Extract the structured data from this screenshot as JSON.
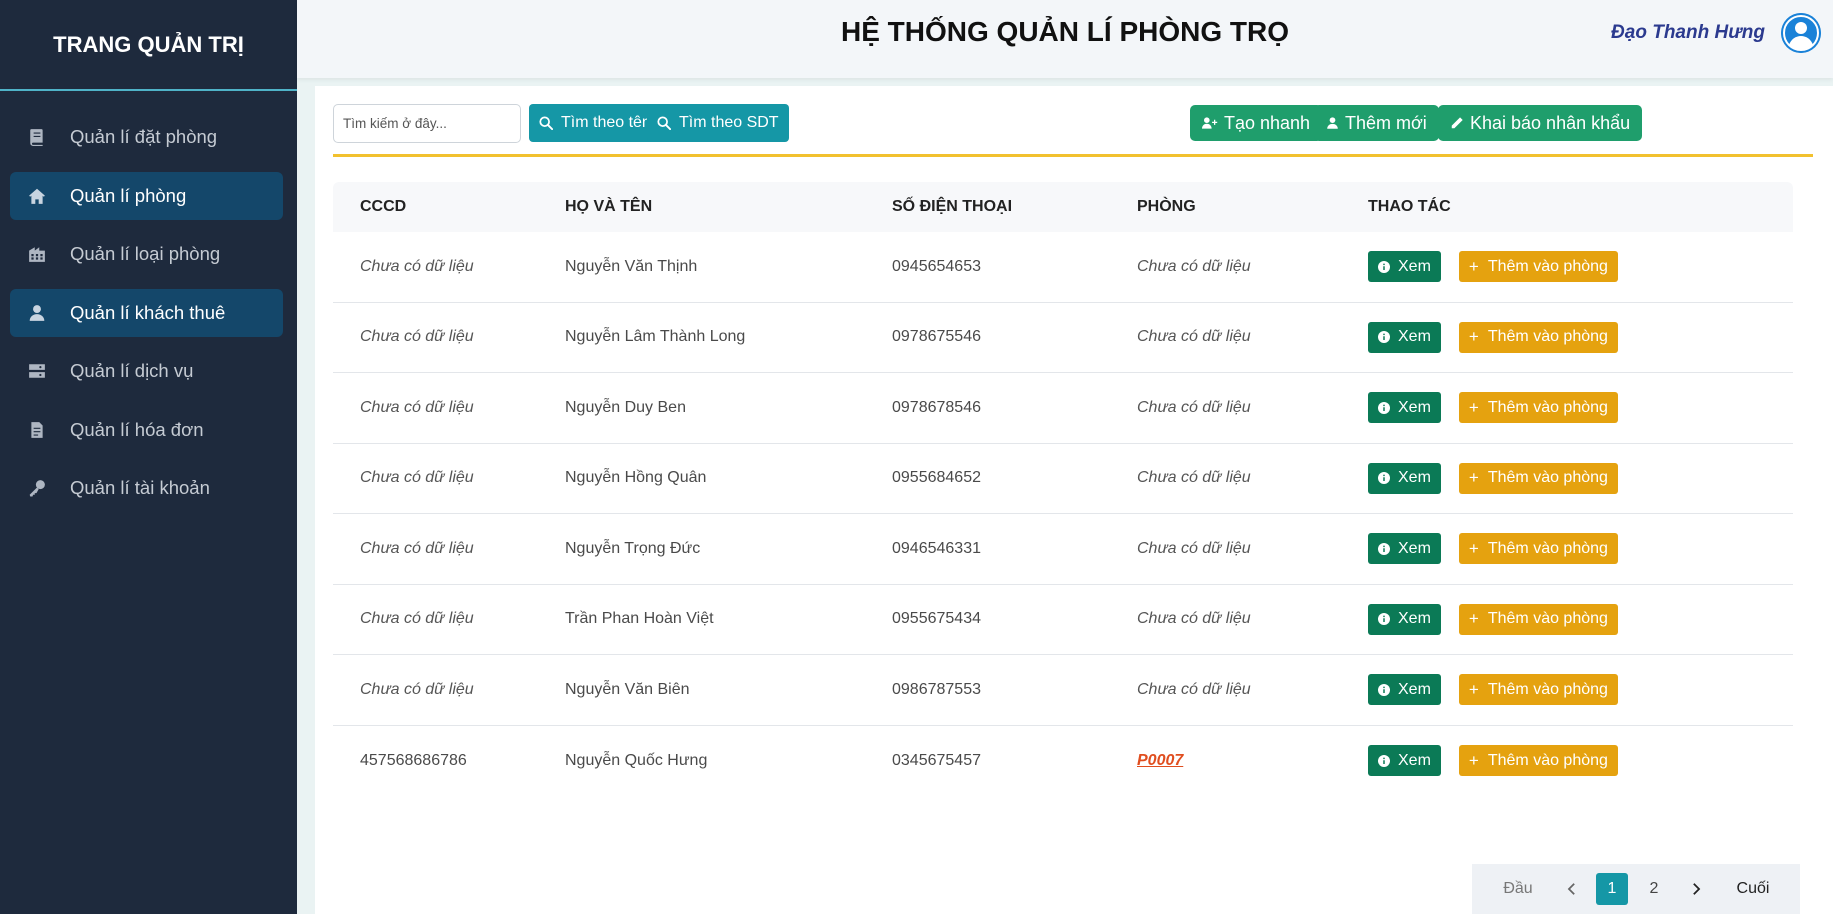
{
  "sidebar": {
    "brand": "TRANG QUẢN TRỊ",
    "items": [
      {
        "label": "Quản lí đặt phòng",
        "icon": "book-icon",
        "active": false
      },
      {
        "label": "Quản lí phòng",
        "icon": "home-icon",
        "active": true
      },
      {
        "label": "Quản lí loại phòng",
        "icon": "building-icon",
        "active": false
      },
      {
        "label": "Quản lí khách thuê",
        "icon": "user-icon",
        "active": true
      },
      {
        "label": "Quản lí dịch vụ",
        "icon": "server-icon",
        "active": false
      },
      {
        "label": "Quản lí hóa đơn",
        "icon": "invoice-icon",
        "active": false
      },
      {
        "label": "Quản lí tài khoản",
        "icon": "key-icon",
        "active": false
      }
    ]
  },
  "header": {
    "title": "HỆ THỐNG QUẢN LÍ PHÒNG TRỌ",
    "user_name": "Đạo Thanh Hưng"
  },
  "toolbar": {
    "search_placeholder": "Tìm kiếm ở đây...",
    "search_by_name": "Tìm theo tên",
    "search_by_phone": "Tìm theo SDT",
    "quick_create": "Tạo nhanh",
    "add_new": "Thêm mới",
    "declare_residents": "Khai báo nhân khẩu"
  },
  "table": {
    "headers": [
      "CCCD",
      "HỌ VÀ TÊN",
      "SỐ ĐIỆN THOẠI",
      "PHÒNG",
      "THAO TÁC"
    ],
    "view_label": "Xem",
    "add_to_room_label": "Thêm vào phòng",
    "rows": [
      {
        "cccd": "Chưa có dữ liệu",
        "name": "Nguyễn Văn Thịnh",
        "phone": "0945654653",
        "room": "Chưa có dữ liệu"
      },
      {
        "cccd": "Chưa có dữ liệu",
        "name": "Nguyễn Lâm Thành Long",
        "phone": "0978675546",
        "room": "Chưa có dữ liệu"
      },
      {
        "cccd": "Chưa có dữ liệu",
        "name": "Nguyễn Duy Ben",
        "phone": "0978678546",
        "room": "Chưa có dữ liệu"
      },
      {
        "cccd": "Chưa có dữ liệu",
        "name": "Nguyễn Hồng Quân",
        "phone": "0955684652",
        "room": "Chưa có dữ liệu"
      },
      {
        "cccd": "Chưa có dữ liệu",
        "name": "Nguyễn Trọng Đức",
        "phone": "0946546331",
        "room": "Chưa có dữ liệu"
      },
      {
        "cccd": "Chưa có dữ liệu",
        "name": "Trần Phan Hoàn Việt",
        "phone": "0955675434",
        "room": "Chưa có dữ liệu"
      },
      {
        "cccd": "Chưa có dữ liệu",
        "name": "Nguyễn Văn Biên",
        "phone": "0986787553",
        "room": "Chưa có dữ liệu"
      },
      {
        "cccd": "457568686786",
        "name": "Nguyễn Quốc Hưng",
        "phone": "0345675457",
        "room": "P0007"
      }
    ]
  },
  "pagination": {
    "first": "Đầu",
    "pages": [
      "1",
      "2"
    ],
    "current": "1",
    "last": "Cuối"
  },
  "colors": {
    "sidebar_bg": "#1e2a3d",
    "active_item": "#14476a",
    "teal": "#1597a6",
    "green": "#1f9e6c",
    "view": "#0b7a56",
    "add": "#e5a20f",
    "accent_line": "#f2c12e",
    "room_link": "#e04e1f"
  }
}
